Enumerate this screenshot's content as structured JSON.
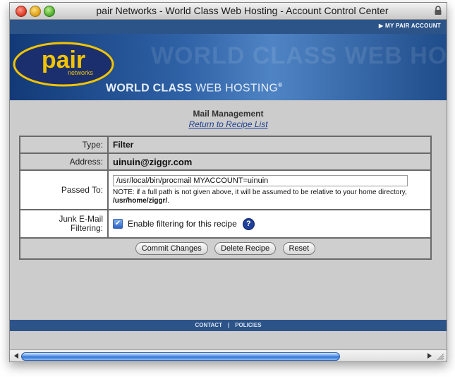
{
  "window": {
    "title": "pair Networks - World Class Web Hosting - Account Control Center"
  },
  "topnav": {
    "my_account": "▶ MY PAIR ACCOUNT"
  },
  "banner": {
    "logo_text": "pair",
    "logo_sub": "networks",
    "tagline_bold": "WORLD CLASS",
    "tagline_rest": " WEB HOSTING",
    "tagline_mark": "®",
    "ghost_text": "WORLD CLASS WEB HOSTING"
  },
  "main": {
    "title": "Mail Management",
    "return_link": "Return to Recipe List"
  },
  "recipe": {
    "type_label": "Type:",
    "type_value": "Filter",
    "address_label": "Address:",
    "address_value": "uinuin@ziggr.com",
    "passed_label": "Passed To:",
    "passed_value": "/usr/local/bin/procmail MYACCOUNT=uinuin",
    "note_text": "NOTE: if a full path is not given above, it will be assumed to be relative to your home directory,",
    "note_path": "/usr/home/ziggr/",
    "note_end": ".",
    "junk_label_line1": "Junk E-Mail",
    "junk_label_line2": "Filtering:",
    "junk_checked": true,
    "junk_checkbox_glyph": "✔",
    "junk_checkbox_label": "Enable filtering for this recipe",
    "help_glyph": "?"
  },
  "buttons": {
    "commit": "Commit Changes",
    "delete": "Delete Recipe",
    "reset": "Reset"
  },
  "footer": {
    "contact": "CONTACT",
    "separator": "|",
    "policies": "POLICIES"
  },
  "colors": {
    "brand_blue": "#2c5489",
    "logo_yellow": "#f2c400",
    "link_blue": "#1f3f8f"
  }
}
